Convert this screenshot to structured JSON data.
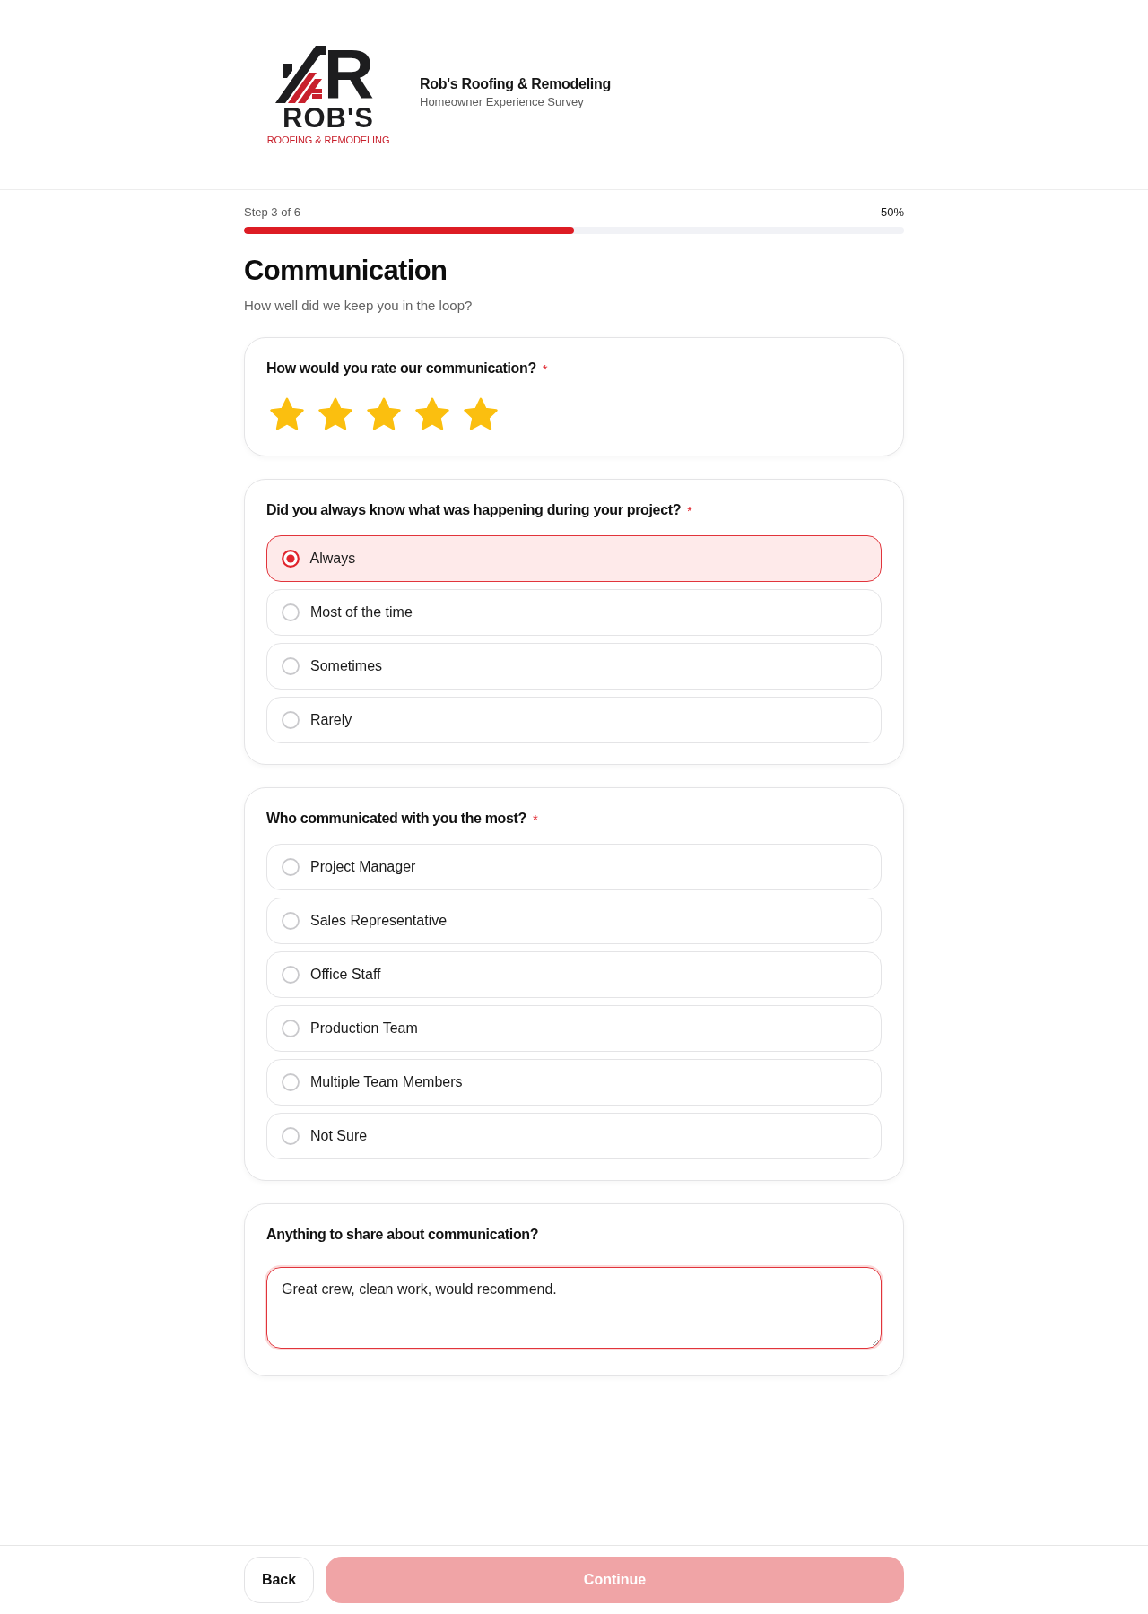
{
  "header": {
    "logo": {
      "letter": "R",
      "wordmark": "ROB'S",
      "tagline": "ROOFING & REMODELING"
    },
    "brand_name": "Rob's Roofing & Remodeling",
    "subtitle": "Homeowner Experience Survey"
  },
  "progress": {
    "step_label": "Step 3 of 6",
    "percent": "50%",
    "level": 0.5
  },
  "section": {
    "title": "Communication",
    "subtitle": "How well did we keep you in the loop?"
  },
  "questions": [
    {
      "kind": "rating",
      "label": "How would you rate our communication?",
      "required_mark": "*",
      "stars": 5
    },
    {
      "kind": "choice",
      "label": "Did you always know what was happening during your project?",
      "required_mark": "*",
      "options": [
        {
          "label": "Always",
          "selected": true
        },
        {
          "label": "Most of the time",
          "selected": false
        },
        {
          "label": "Sometimes",
          "selected": false
        },
        {
          "label": "Rarely",
          "selected": false
        }
      ]
    },
    {
      "kind": "choice",
      "label": "Who communicated with you the most?",
      "required_mark": "*",
      "options": [
        {
          "label": "Project Manager",
          "selected": false
        },
        {
          "label": "Sales Representative",
          "selected": false
        },
        {
          "label": "Office Staff",
          "selected": false
        },
        {
          "label": "Production Team",
          "selected": false
        },
        {
          "label": "Multiple Team Members",
          "selected": false
        },
        {
          "label": "Not Sure",
          "selected": false
        }
      ]
    },
    {
      "kind": "text",
      "label": "Anything to share about communication?",
      "value": "Great crew, clean work, would recommend.",
      "focused": true
    }
  ],
  "footer": {
    "back": {
      "label": "Back"
    },
    "continue": {
      "label": "Continue",
      "disabled": true
    }
  }
}
